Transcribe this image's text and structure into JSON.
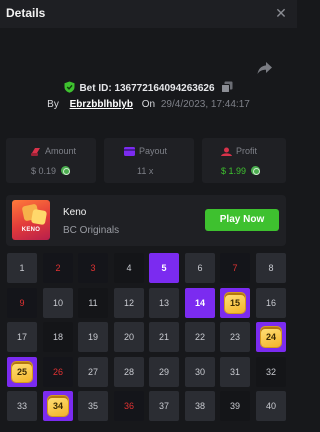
{
  "header": {
    "title": "Details",
    "close_label": "✕"
  },
  "bet": {
    "id_label": "Bet ID: 136772164094263626",
    "by": "By",
    "user": "Ebrzbblhblyb",
    "on": "On",
    "datetime": "29/4/2023, 17:44:17"
  },
  "stats": [
    {
      "label": "Amount",
      "value": "$ 0.19",
      "value_color": "#7e8088"
    },
    {
      "label": "Payout",
      "value": "11 x",
      "value_color": "#7e8088"
    },
    {
      "label": "Profit",
      "value": "$ 1.99",
      "value_color": "#3ec12f"
    }
  ],
  "game": {
    "name": "Keno",
    "provider": "BC Originals",
    "thumb_text": "KENO",
    "play_label": "Play Now"
  },
  "board": {
    "cells": [
      {
        "n": "1",
        "state": "normal"
      },
      {
        "n": "2",
        "state": "hit"
      },
      {
        "n": "3",
        "state": "hit"
      },
      {
        "n": "4",
        "state": "normal"
      },
      {
        "n": "5",
        "state": "pick"
      },
      {
        "n": "6",
        "state": "normal"
      },
      {
        "n": "7",
        "state": "hit"
      },
      {
        "n": "8",
        "state": "normal"
      },
      {
        "n": "9",
        "state": "hit"
      },
      {
        "n": "10",
        "state": "normal"
      },
      {
        "n": "11",
        "state": "normal"
      },
      {
        "n": "12",
        "state": "normal"
      },
      {
        "n": "13",
        "state": "normal"
      },
      {
        "n": "14",
        "state": "pick"
      },
      {
        "n": "15",
        "state": "win"
      },
      {
        "n": "16",
        "state": "normal"
      },
      {
        "n": "17",
        "state": "normal"
      },
      {
        "n": "18",
        "state": "normal"
      },
      {
        "n": "19",
        "state": "normal"
      },
      {
        "n": "20",
        "state": "normal"
      },
      {
        "n": "21",
        "state": "normal"
      },
      {
        "n": "22",
        "state": "normal"
      },
      {
        "n": "23",
        "state": "normal"
      },
      {
        "n": "24",
        "state": "win"
      },
      {
        "n": "25",
        "state": "win"
      },
      {
        "n": "26",
        "state": "hit"
      },
      {
        "n": "27",
        "state": "normal"
      },
      {
        "n": "28",
        "state": "normal"
      },
      {
        "n": "29",
        "state": "normal"
      },
      {
        "n": "30",
        "state": "normal"
      },
      {
        "n": "31",
        "state": "normal"
      },
      {
        "n": "32",
        "state": "normal"
      },
      {
        "n": "33",
        "state": "normal"
      },
      {
        "n": "34",
        "state": "win"
      },
      {
        "n": "35",
        "state": "normal"
      },
      {
        "n": "36",
        "state": "hit"
      },
      {
        "n": "37",
        "state": "normal"
      },
      {
        "n": "38",
        "state": "normal"
      },
      {
        "n": "39",
        "state": "normal"
      },
      {
        "n": "40",
        "state": "normal"
      }
    ]
  },
  "colors": {
    "accent": "#7b2bf0",
    "play": "#3ec12f",
    "hit": "#e13232",
    "gem": "#f3b52a"
  },
  "icons": {
    "shield": "shield-check-icon",
    "copy": "copy-icon",
    "share": "share-arrow-icon",
    "close": "close-icon"
  }
}
